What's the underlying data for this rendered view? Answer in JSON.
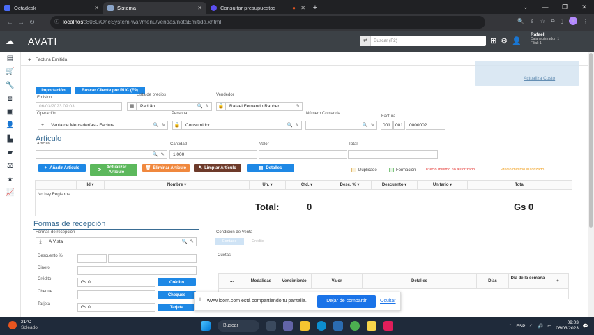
{
  "browser": {
    "tabs": [
      {
        "label": "Octadesk",
        "color": "#4a6cf7"
      },
      {
        "label": "Sistema",
        "color": "#8aa4c8"
      },
      {
        "label": "Consultar presupuestos",
        "color": "#5b4ff1"
      }
    ],
    "url_host": "localhost",
    "url_path": ":8080/OneSystem-war/menu/vendas/notaEmitida.xhtml",
    "profile_initial": "Y"
  },
  "app": {
    "logo": "AVATI",
    "search_placeholder": "Buscar (F2)",
    "user_name": "Rafael",
    "user_caja": "Caja registrador: 1",
    "user_filial": "Filial: 1",
    "breadcrumb": "Factura Emitida",
    "notify_link": "Actualiza Costo"
  },
  "form": {
    "btn_importacion": "Importación",
    "btn_buscar_cliente": "Buscar Cliente por RUC (F9)",
    "emision_label": "Emision",
    "emision_value": "06/03/2023 09:03",
    "lista_label": "Lista de precios",
    "lista_value": "Padrão",
    "vendedor_label": "Vendedor",
    "vendedor_value": "Rafael Fernando Rauber",
    "operacion_label": "Operación",
    "operacion_value": "Venta de Mercaderías - Factura",
    "persona_label": "Persona",
    "persona_value": "Consumidor",
    "numero_label": "Número Comanda",
    "factura_label": "Factura",
    "factura_1": "001",
    "factura_2": "001",
    "factura_3": "0000002",
    "articulo_title": "Artículo",
    "articulo_label": "Artículo",
    "cantidad_label": "Cantidad",
    "cantidad_value": "1,000",
    "valor_label": "Valor",
    "total_label": "Total",
    "btn_anadir": "Añadir Artículo",
    "btn_actualizar": "Actualizar Artículo",
    "btn_eliminar": "Eliminar Artículo",
    "btn_limpiar": "Limpiar Artículo",
    "btn_detalles": "Detalles",
    "chk_duplicado": "Duplicado",
    "chk_formacion": "Formación",
    "warn_no_autorizado": "Precio mínimo no autorizado",
    "warn_autorizado": "Precio mínimo autorizado",
    "colors": {
      "duplicado": "#e0b870",
      "formacion": "#7ec47e",
      "no_autorizado": "#e53935",
      "autorizado": "#f0a020"
    }
  },
  "items_table": {
    "columns": [
      "Id ▾",
      "Nombre ▾",
      "Un. ▾",
      "Ctd. ▾",
      "Desc. % ▾",
      "Descuento ▾",
      "Unitario ▾",
      "Total"
    ],
    "empty": "No hay Registros",
    "total_label": "Total:",
    "total_qty": "0",
    "total_value": "Gs 0"
  },
  "recepcion": {
    "title": "Formas de recepción",
    "formas_label": "Formas de recepción",
    "formas_value": "A Vista",
    "descuento_label": "Descuento %",
    "dinero_label": "Dinero",
    "credito_label": "Crédito",
    "credito_value": "Gs 0",
    "btn_credito": "Crédito",
    "cheque_label": "Cheque",
    "btn_cheques": "Cheques",
    "tarjeta_label": "Tarjeta",
    "tarjeta_value": "Gs 0",
    "btn_tarjeta": "Tarjeta",
    "condicion_label": "Condición de Venta",
    "opt_contado": "Contado",
    "opt_credito": "Crédito",
    "cuotas_label": "Cuotas",
    "cuotas_columns": [
      "...",
      "Modalidad",
      "Vencimiento",
      "Valor",
      "Detalles",
      "Días",
      "Día de la semana",
      "+"
    ]
  },
  "loom": {
    "text": "www.loom.com está compartiendo tu pantalla.",
    "stop": "Dejar de compartir",
    "hide": "Ocultar"
  },
  "taskbar": {
    "temp": "21°C",
    "weather": "Soleado",
    "search": "Buscar",
    "lang": "ESP",
    "time": "09:03",
    "date": "06/03/2023"
  }
}
